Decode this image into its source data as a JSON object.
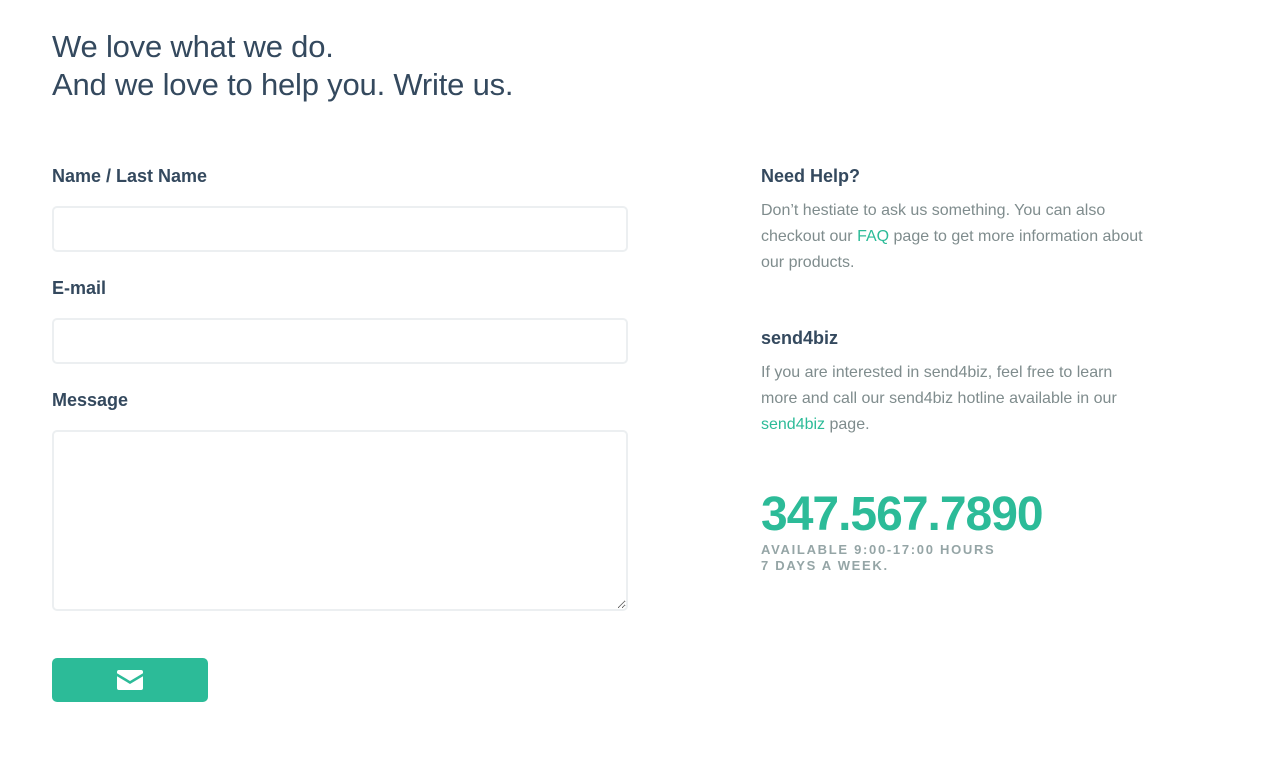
{
  "header": {
    "line1": "We love what we do.",
    "line2": "And we love to help you. Write us."
  },
  "form": {
    "name_label": "Name / Last Name",
    "name_value": "",
    "email_label": "E-mail",
    "email_value": "",
    "message_label": "Message",
    "message_value": "",
    "submit_icon": "envelope-icon"
  },
  "help": {
    "title": "Need Help?",
    "text_before": "Don’t hestiate to ask us something. You can also checkout our ",
    "faq_link": "FAQ",
    "text_after": " page to get more information about our products."
  },
  "biz": {
    "title": "send4biz",
    "text_before": "If you are interested in send4biz, feel free to learn more and call our send4biz hotline available in our ",
    "link": "send4biz",
    "text_after": " page."
  },
  "hotline": {
    "phone": "347.567.7890",
    "line1": "AVAILABLE 9:00-17:00 HOURS",
    "line2": "7 DAYS A WEEK."
  },
  "colors": {
    "accent": "#2cbb98",
    "heading": "#34495e",
    "muted": "#7f8c8d",
    "field_border": "#eceff1"
  }
}
